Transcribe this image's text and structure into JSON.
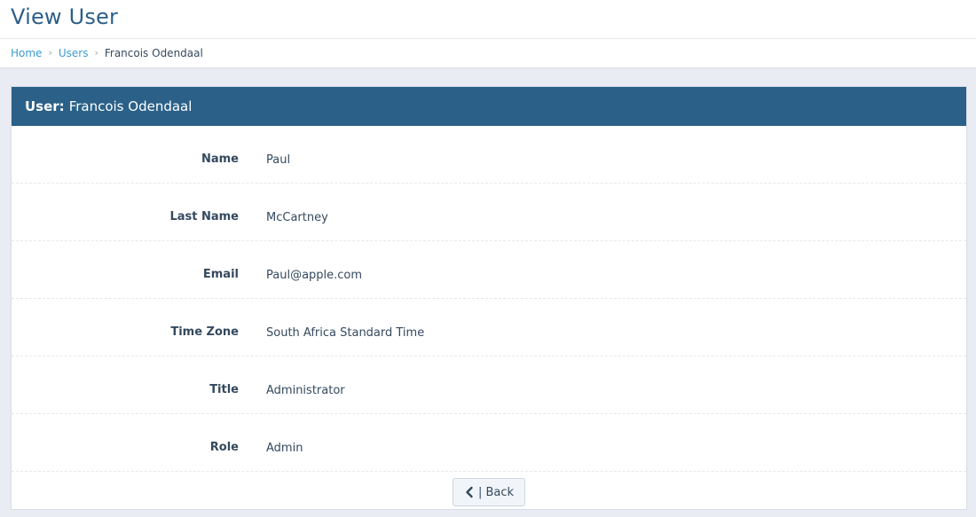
{
  "header": {
    "title": "View User"
  },
  "breadcrumb": {
    "home": "Home",
    "users": "Users",
    "current": "Francois Odendaal",
    "separator": "›"
  },
  "panel": {
    "heading_prefix": "User:",
    "heading_name": "Francois Odendaal",
    "heading_color": "#2b6188"
  },
  "fields": [
    {
      "label": "Name",
      "value": "Paul"
    },
    {
      "label": "Last Name",
      "value": "McCartney"
    },
    {
      "label": "Email",
      "value": "Paul@apple.com"
    },
    {
      "label": "Time Zone",
      "value": "South Africa Standard Time"
    },
    {
      "label": "Title",
      "value": "Administrator"
    },
    {
      "label": "Role",
      "value": "Admin"
    }
  ],
  "actions": {
    "back_label": "| Back",
    "back_icon": "chevron-left-icon"
  }
}
